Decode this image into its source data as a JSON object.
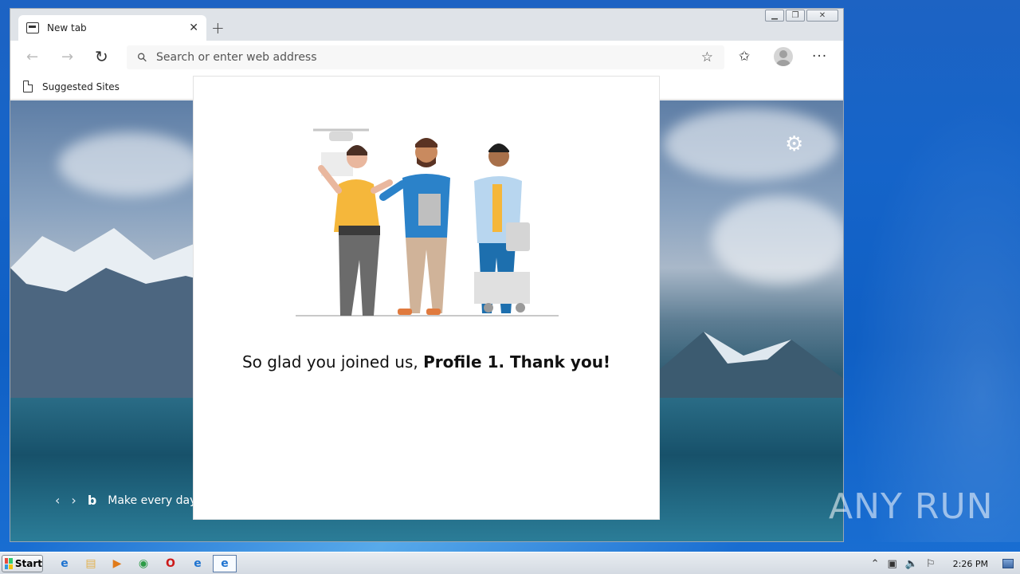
{
  "browser": {
    "tab": {
      "title": "New tab",
      "close_glyph": "✕"
    },
    "new_tab_glyph": "+",
    "address_placeholder": "Search or enter web address",
    "favorites_bar": {
      "items": [
        {
          "label": "Suggested Sites",
          "icon": "page-icon"
        }
      ]
    },
    "caption": {
      "minimize": "▁",
      "restore": "❐",
      "close": "✕"
    }
  },
  "newtab": {
    "bing_text": "Make every day",
    "bing_logo": "b",
    "nav_prev": "‹",
    "nav_next": "›"
  },
  "dialog": {
    "message_prefix": "So glad you joined us, ",
    "message_bold": "Profile 1. Thank you!"
  },
  "watermark": {
    "text": "ANY RUN"
  },
  "taskbar": {
    "start_label": "Start",
    "clock": "2:26 PM"
  },
  "colors": {
    "accent_blue": "#0078d4",
    "shirt_yellow": "#f5b73b",
    "shirt_blue": "#2b82c9"
  }
}
